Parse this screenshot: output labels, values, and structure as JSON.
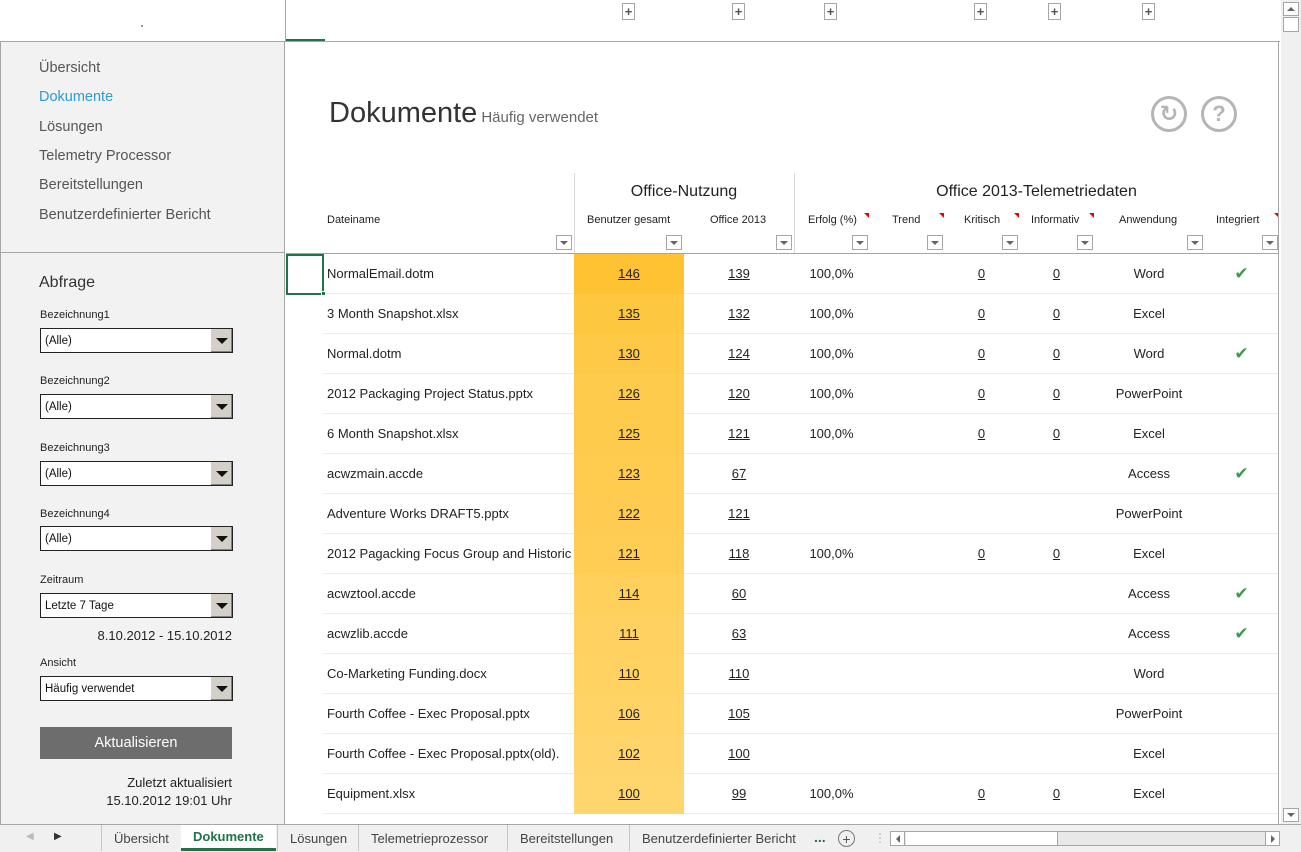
{
  "sidebar": {
    "nav": [
      {
        "label": "Übersicht",
        "active": false
      },
      {
        "label": "Dokumente",
        "active": true
      },
      {
        "label": "Lösungen",
        "active": false
      },
      {
        "label": "Telemetry Processor",
        "active": false
      },
      {
        "label": "Bereitstellungen",
        "active": false
      },
      {
        "label": "Benutzerdefinierter Bericht",
        "active": false
      }
    ],
    "query_title": "Abfrage",
    "filters": [
      {
        "label": "Bezeichnung1",
        "value": "(Alle)"
      },
      {
        "label": "Bezeichnung2",
        "value": "(Alle)"
      },
      {
        "label": "Bezeichnung3",
        "value": "(Alle)"
      },
      {
        "label": "Bezeichnung4",
        "value": "(Alle)"
      },
      {
        "label": "Zeitraum",
        "value": "Letzte 7 Tage"
      },
      {
        "label": "Ansicht",
        "value": "Häufig verwendet"
      }
    ],
    "date_range": "8.10.2012 - 15.10.2012",
    "refresh_label": "Aktualisieren",
    "last_updated_label": "Zuletzt aktualisiert",
    "last_updated_value": "15.10.2012 19:01 Uhr"
  },
  "header": {
    "title": "Dokumente",
    "subtitle": "Häufig verwendet",
    "refresh_icon": "↻",
    "help_icon": "?"
  },
  "table": {
    "groups": [
      "Office-Nutzung",
      "Office 2013-Telemetriedaten"
    ],
    "columns": [
      "Dateiname",
      "Benutzer gesamt",
      "Office 2013",
      "Erfolg (%)",
      "Trend",
      "Kritisch",
      "Informativ",
      "Anwendung",
      "Integriert"
    ],
    "rows": [
      {
        "file": "NormalEmail.dotm",
        "users": "146",
        "o2013": "139",
        "success": "100,0%",
        "critical": "0",
        "info": "0",
        "app": "Word",
        "integrated": true
      },
      {
        "file": "3 Month Snapshot.xlsx",
        "users": "135",
        "o2013": "132",
        "success": "100,0%",
        "critical": "0",
        "info": "0",
        "app": "Excel",
        "integrated": false
      },
      {
        "file": "Normal.dotm",
        "users": "130",
        "o2013": "124",
        "success": "100,0%",
        "critical": "0",
        "info": "0",
        "app": "Word",
        "integrated": true
      },
      {
        "file": "2012 Packaging Project Status.pptx",
        "users": "126",
        "o2013": "120",
        "success": "100,0%",
        "critical": "0",
        "info": "0",
        "app": "PowerPoint",
        "integrated": false
      },
      {
        "file": "6 Month Snapshot.xlsx",
        "users": "125",
        "o2013": "121",
        "success": "100,0%",
        "critical": "0",
        "info": "0",
        "app": "Excel",
        "integrated": false
      },
      {
        "file": "acwzmain.accde",
        "users": "123",
        "o2013": "67",
        "success": "",
        "critical": "",
        "info": "",
        "app": "Access",
        "integrated": true
      },
      {
        "file": "Adventure Works DRAFT5.pptx",
        "users": "122",
        "o2013": "121",
        "success": "",
        "critical": "",
        "info": "",
        "app": "PowerPoint",
        "integrated": false
      },
      {
        "file": "2012 Pagacking Focus Group and Historic",
        "users": "121",
        "o2013": "118",
        "success": "100,0%",
        "critical": "0",
        "info": "0",
        "app": "Excel",
        "integrated": false
      },
      {
        "file": "acwztool.accde",
        "users": "114",
        "o2013": "60",
        "success": "",
        "critical": "",
        "info": "",
        "app": "Access",
        "integrated": true
      },
      {
        "file": "acwzlib.accde",
        "users": "111",
        "o2013": "63",
        "success": "",
        "critical": "",
        "info": "",
        "app": "Access",
        "integrated": true
      },
      {
        "file": "Co-Marketing Funding.docx",
        "users": "110",
        "o2013": "110",
        "success": "",
        "critical": "",
        "info": "",
        "app": "Word",
        "integrated": false
      },
      {
        "file": "Fourth Coffee - Exec Proposal.pptx",
        "users": "106",
        "o2013": "105",
        "success": "",
        "critical": "",
        "info": "",
        "app": "PowerPoint",
        "integrated": false
      },
      {
        "file": "Fourth Coffee - Exec Proposal.pptx(old).",
        "users": "102",
        "o2013": "100",
        "success": "",
        "critical": "",
        "info": "",
        "app": "Excel",
        "integrated": false
      },
      {
        "file": "Equipment.xlsx",
        "users": "100",
        "o2013": "99",
        "success": "100,0%",
        "critical": "0",
        "info": "0",
        "app": "Excel",
        "integrated": false
      }
    ],
    "heat_colors": {
      "max": "#fec232",
      "min": "#ffd66e"
    },
    "check_icon": "✔"
  },
  "sheet_tabs": {
    "tabs": [
      {
        "label": "Übersicht",
        "active": false
      },
      {
        "label": "Dokumente",
        "active": true
      },
      {
        "label": "Lösungen",
        "active": false
      },
      {
        "label": "Telemetrieprozessor",
        "active": false
      },
      {
        "label": "Bereitstellungen",
        "active": false
      },
      {
        "label": "Benutzerdefinierter Bericht",
        "active": false
      }
    ],
    "more": "...",
    "add_icon": "+"
  }
}
